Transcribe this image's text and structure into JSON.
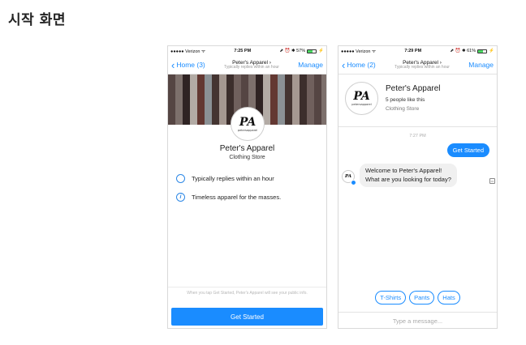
{
  "page": {
    "heading": "시작 화면"
  },
  "screen1": {
    "status": {
      "carrier": "●●●●● Verizon ᯤ",
      "time": "7:25 PM",
      "extras": "⬈ ⏰ ✱ 57%",
      "battery_level": 0.57,
      "charge": "⚡"
    },
    "nav": {
      "back_label": "Home (3)",
      "title": "Peter's Apparel ›",
      "subtitle": "Typically replies within an hour",
      "manage_label": "Manage"
    },
    "logo": {
      "mark": "PA",
      "sub": "petersapparel"
    },
    "brand_name": "Peter's Apparel",
    "category": "Clothing Store",
    "info": [
      {
        "icon": "clock-icon",
        "text": "Typically replies within an hour"
      },
      {
        "icon": "info-icon",
        "glyph": "i",
        "text": "Timeless apparel for the masses."
      }
    ],
    "footer_note": "When you tap Get Started, Peter's Apparel will see your public info.",
    "cta_label": "Get Started",
    "colors": {
      "accent": "#1a8cff",
      "cover": "#3a2b2a"
    }
  },
  "screen2": {
    "status": {
      "carrier": "●●●●● Verizon ᯤ",
      "time": "7:29 PM",
      "extras": "⬈ ⏰ ✱ 61%",
      "battery_level": 0.61,
      "charge": "⚡"
    },
    "nav": {
      "back_label": "Home (2)",
      "title": "Peter's Apparel ›",
      "subtitle": "Typically replies within an hour",
      "manage_label": "Manage"
    },
    "logo": {
      "mark": "PA",
      "sub": "petersapparel"
    },
    "profile": {
      "name": "Peter's Apparel",
      "likes": "5 people like this",
      "category": "Clothing Store"
    },
    "timestamp": "7:27 PM",
    "outgoing": "Get Started",
    "incoming_line1": "Welcome to Peter's Apparel!",
    "incoming_line2": "What are you looking for today?",
    "mini_avatar": "PA",
    "quick_replies": [
      "T-Shirts",
      "Pants",
      "Hats"
    ],
    "compose_placeholder": "Type a message..."
  }
}
